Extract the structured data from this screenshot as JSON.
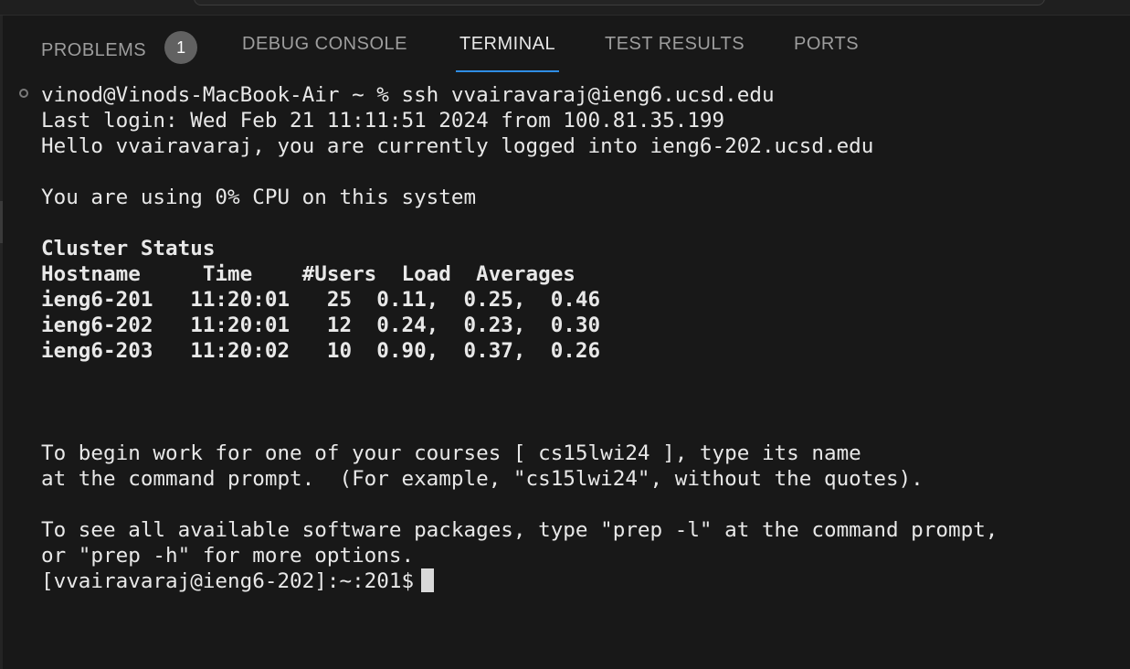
{
  "top_bar": {
    "search_placeholder": ""
  },
  "panel": {
    "tabs": [
      {
        "label": "PROBLEMS",
        "badge": "1",
        "active": false
      },
      {
        "label": "DEBUG CONSOLE",
        "active": false
      },
      {
        "label": "TERMINAL",
        "active": true
      },
      {
        "label": "TEST RESULTS",
        "active": false
      },
      {
        "label": "PORTS",
        "active": false
      }
    ]
  },
  "terminal": {
    "lines": [
      {
        "text": "vinod@Vinods-MacBook-Air ~ % ssh vvairavaraj@ieng6.ucsd.edu",
        "bold": false
      },
      {
        "text": "Last login: Wed Feb 21 11:11:51 2024 from 100.81.35.199",
        "bold": false
      },
      {
        "text": "Hello vvairavaraj, you are currently logged into ieng6-202.ucsd.edu",
        "bold": false
      },
      {
        "text": "",
        "bold": false
      },
      {
        "text": "You are using 0% CPU on this system",
        "bold": false
      },
      {
        "text": "",
        "bold": false
      },
      {
        "text": "Cluster Status",
        "bold": true
      },
      {
        "text": "Hostname     Time    #Users  Load  Averages",
        "bold": true
      },
      {
        "text": "ieng6-201   11:20:01   25  0.11,  0.25,  0.46",
        "bold": true
      },
      {
        "text": "ieng6-202   11:20:01   12  0.24,  0.23,  0.30",
        "bold": true
      },
      {
        "text": "ieng6-203   11:20:02   10  0.90,  0.37,  0.26",
        "bold": true
      },
      {
        "text": "",
        "bold": false
      },
      {
        "text": "",
        "bold": false
      },
      {
        "text": "",
        "bold": false
      },
      {
        "text": "To begin work for one of your courses [ cs15lwi24 ], type its name",
        "bold": false
      },
      {
        "text": "at the command prompt.  (For example, \"cs15lwi24\", without the quotes).",
        "bold": false
      },
      {
        "text": "",
        "bold": false
      },
      {
        "text": "To see all available software packages, type \"prep -l\" at the command prompt,",
        "bold": false
      },
      {
        "text": "or \"prep -h\" for more options.",
        "bold": false
      }
    ],
    "prompt": "[vvairavaraj@ieng6-202]:~:201$"
  }
}
